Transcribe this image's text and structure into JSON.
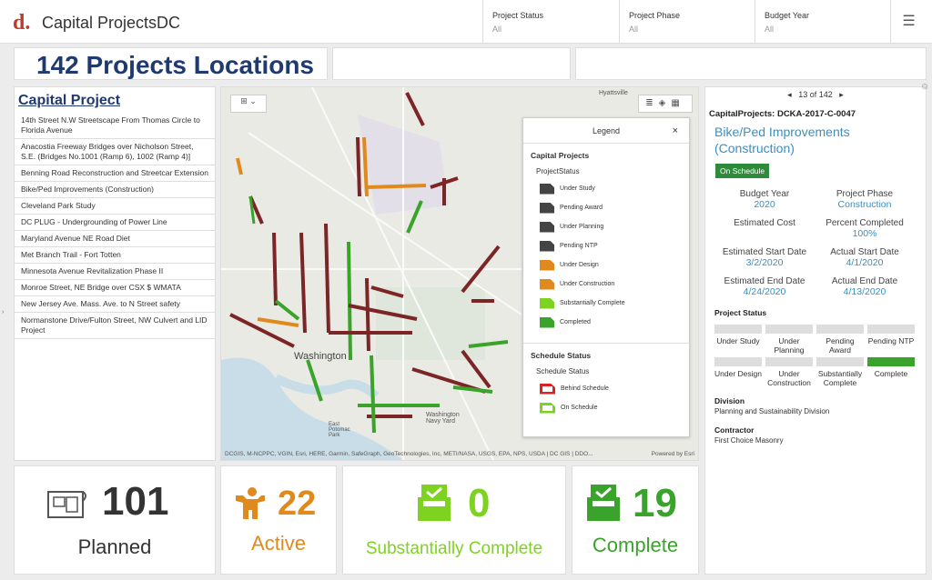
{
  "header": {
    "logo": "d.",
    "title": "Capital ProjectsDC",
    "filters": [
      {
        "label": "Project Status",
        "value": "All"
      },
      {
        "label": "Project Phase",
        "value": "All"
      },
      {
        "label": "Budget Year",
        "value": "All"
      }
    ],
    "menu_icon": "☰"
  },
  "main_title": "142 Projects Locations",
  "list": {
    "title": "Capital Project",
    "items": [
      "14th Street N.W Streetscape From Thomas Circle to Florida Avenue",
      "Anacostia Freeway Bridges over Nicholson Street, S.E. (Bridges No.1001 (Ramp 6), 1002 (Ramp 4)]",
      "Benning Road Reconstruction and Streetcar Extension",
      "Bike/Ped Improvements (Construction)",
      "Cleveland Park Study",
      "DC PLUG - Undergrounding of Power Line",
      "Maryland Avenue NE Road Diet",
      "Met Branch Trail - Fort Totten",
      "Minnesota Avenue Revitalization Phase II",
      "Monroe Street, NE Bridge over CSX $ WMATA",
      "New Jersey Ave. Mass. Ave. to N Street safety",
      "Normanstone Drive/Fulton Street, NW Culvert and LID Project"
    ]
  },
  "map": {
    "labels": {
      "washington": "Washington",
      "hyattsville": "Hyattsville",
      "navy_yard": "Washington\nNavy Yard",
      "east_potomac": "East\nPotomac\nPark"
    },
    "attribution": "DCGIS, M-NCPPC, VGIN, Esri, HERE, Garmin, SafeGraph, GeoTechnologies, Inc, METI/NASA, USGS, EPA, NPS, USDA | DC GIS | DDO...",
    "powered": "Powered by Esri",
    "legend": {
      "title": "Legend",
      "close": "×",
      "section1": "Capital Projects",
      "sub1": "ProjectStatus",
      "items": [
        {
          "label": "Under Study",
          "color": "#444444"
        },
        {
          "label": "Pending Award",
          "color": "#444444"
        },
        {
          "label": "Under Planning",
          "color": "#444444"
        },
        {
          "label": "Pending NTP",
          "color": "#444444"
        },
        {
          "label": "Under Design",
          "color": "#e08a1e"
        },
        {
          "label": "Under Construction",
          "color": "#e08a1e"
        },
        {
          "label": "Substantially Complete",
          "color": "#7ed321"
        },
        {
          "label": "Completed",
          "color": "#3aa32b"
        }
      ],
      "section2": "Schedule Status",
      "sub2": "Schedule Status",
      "schedule": [
        {
          "label": "Behind Schedule",
          "color": "#e02020"
        },
        {
          "label": "On Schedule",
          "color": "#7ed321"
        }
      ]
    }
  },
  "stats": [
    {
      "value": "101",
      "label": "Planned",
      "color": "#333333",
      "icon": "blueprint-icon"
    },
    {
      "value": "22",
      "label": "Active",
      "color": "#e08a1e",
      "icon": "worker-icon"
    },
    {
      "value": "0",
      "label": "Substantially Complete",
      "color": "#7ed321",
      "icon": "check-box-icon"
    },
    {
      "value": "19",
      "label": "Complete",
      "color": "#3aa32b",
      "icon": "check-box-icon"
    }
  ],
  "detail": {
    "pager": "13 of 142",
    "id": "CapitalProjects: DCKA-2017-C-0047",
    "name": "Bike/Ped Improvements (Construction)",
    "badge": "On Schedule",
    "fields": [
      {
        "key": "Budget Year",
        "value": "2020"
      },
      {
        "key": "Project Phase",
        "value": "Construction"
      },
      {
        "key": "Estimated Cost",
        "value": ""
      },
      {
        "key": "Percent Completed",
        "value": "100%"
      },
      {
        "key": "Estimated Start Date",
        "value": "3/2/2020"
      },
      {
        "key": "Actual Start Date",
        "value": "4/1/2020"
      },
      {
        "key": "Estimated End Date",
        "value": "4/24/2020"
      },
      {
        "key": "Actual End Date",
        "value": "4/13/2020"
      }
    ],
    "status_title": "Project Status",
    "status_row1": [
      "Under Study",
      "Under Planning",
      "Pending Award",
      "Pending NTP"
    ],
    "status_row2": [
      "Under Design",
      "Under Construction",
      "Substantially Complete",
      "Complete"
    ],
    "division_label": "Division",
    "division": "Planning and Sustainability Division",
    "contractor_label": "Contractor",
    "contractor": "First Choice Masonry"
  }
}
